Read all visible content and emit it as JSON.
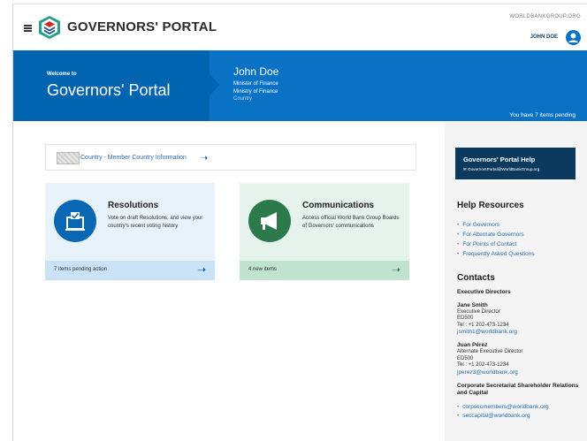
{
  "header": {
    "brand": "GOVERNORS' PORTAL",
    "wbg_link": "WORLDBANKGROUP.ORG",
    "user_name": "JOHN DOE"
  },
  "banner": {
    "welcome_small": "Welcome to",
    "welcome_big": "Governors' Portal",
    "user": {
      "name": "John Doe",
      "title": "Minister of Finance",
      "ministry": "Ministry of Finance",
      "country": "Country"
    },
    "pending_text": "You have 7 items pending"
  },
  "main": {
    "country_link": "Country - Member Country Information",
    "cards": {
      "resolutions": {
        "title": "Resolutions",
        "description": "Vote on draft Resolutions, and view your country's recent voting history",
        "footer": "7 items pending action"
      },
      "communications": {
        "title": "Communications",
        "description": "Access official World Bank Group Boards of Governors' communications",
        "footer": "4 new items"
      }
    }
  },
  "sidebar": {
    "help_title": "Governors' Portal Help",
    "help_email": "GovernorsPortal@WorldBankGroup.org",
    "resources_heading": "Help Resources",
    "resources": [
      "For Governors",
      "For Alternate Governors",
      "For Points of Contact",
      "Frequently Asked Questions"
    ],
    "contacts_heading": "Contacts",
    "exec_directors_heading": "Executive Directors",
    "contacts": [
      {
        "name": "Jane Smith",
        "role": "Executive Director",
        "code": "ED500",
        "tel": "Tel : +1 202-473-1234",
        "email": "jsmith1@worldbank.org"
      },
      {
        "name": "Juan Pérez",
        "role": "Alternate Executive Director",
        "code": "ED500",
        "tel": "Tel : +1 202-473-1234",
        "email": "jperez3@worldbank.org"
      }
    ],
    "corp_heading": "Corporate Secretariat Shareholder Relations and Capital",
    "corp_emails": [
      "corpsecmembers@worldbank.org",
      "seccapital@worldbank.org"
    ]
  },
  "colors": {
    "banner_dark": "#0064b1",
    "banner": "#0a72c4",
    "help_box": "#0c3a5f",
    "resolutions_accent": "#0a67b3",
    "communications_accent": "#2c7a4b",
    "link": "#2b6cb0"
  },
  "icons": {
    "menu": "hamburger-icon",
    "logo": "governors-portal-logo",
    "user": "user-circle-icon",
    "resolutions": "ballot-box-icon",
    "communications": "megaphone-icon",
    "mail": "mail-icon",
    "arrow": "arrow-right-icon"
  }
}
